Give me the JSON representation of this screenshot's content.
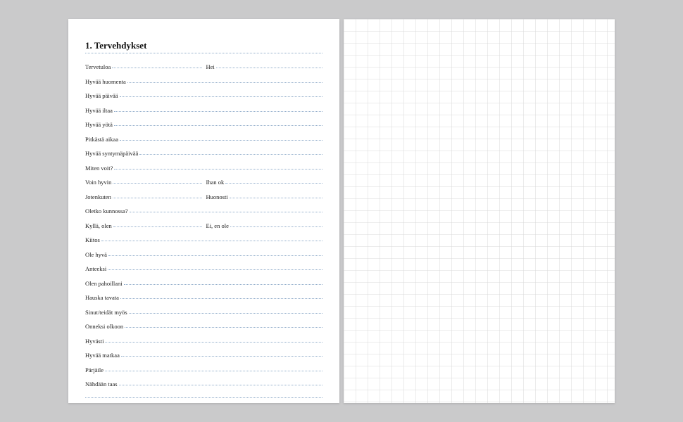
{
  "title": "1. Tervehdykset",
  "rows": [
    {
      "cells": [
        "Tervetuloa",
        "Hei"
      ]
    },
    {
      "cells": [
        "Hyvää huomenta"
      ]
    },
    {
      "cells": [
        "Hyvää päivää"
      ]
    },
    {
      "cells": [
        "Hyvää iltaa"
      ]
    },
    {
      "cells": [
        "Hyvää yötä"
      ]
    },
    {
      "cells": [
        "Pitkästä aikaa"
      ]
    },
    {
      "cells": [
        "Hyvää syntymäpäivää"
      ]
    },
    {
      "cells": [
        "Miten voit?"
      ]
    },
    {
      "cells": [
        "Voin hyvin",
        "Ihan ok"
      ]
    },
    {
      "cells": [
        "Jotenkuten",
        "Huonosti"
      ]
    },
    {
      "cells": [
        "Oletko kunnossa?"
      ]
    },
    {
      "cells": [
        "Kyllä, olen",
        "Ei, en ole"
      ]
    },
    {
      "cells": [
        "Kiitos"
      ]
    },
    {
      "cells": [
        "Ole hyvä"
      ]
    },
    {
      "cells": [
        "Anteeksi"
      ]
    },
    {
      "cells": [
        "Olen pahoillani"
      ]
    },
    {
      "cells": [
        "Hauska tavata"
      ]
    },
    {
      "cells": [
        "Sinut/teidät myös"
      ]
    },
    {
      "cells": [
        "Onneksi olkoon"
      ]
    },
    {
      "cells": [
        "Hyvästi"
      ]
    },
    {
      "cells": [
        "Hyvää matkaa"
      ]
    },
    {
      "cells": [
        "Pärjäile"
      ]
    },
    {
      "cells": [
        "Nähdään taas"
      ]
    }
  ]
}
